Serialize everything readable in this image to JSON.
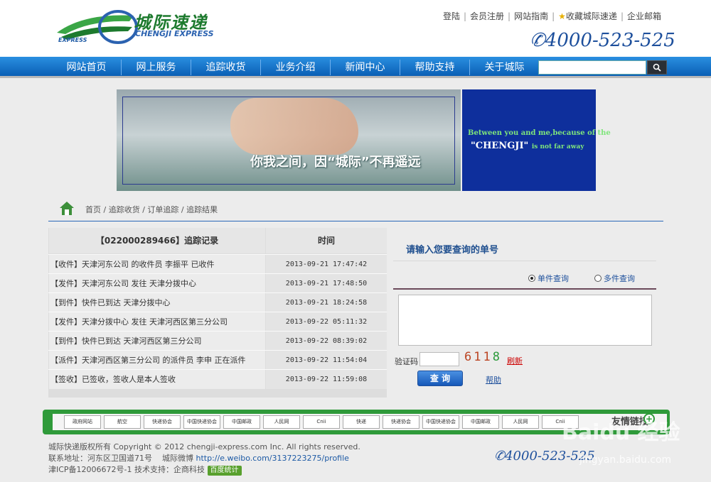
{
  "header": {
    "logo_cn": "城际速递",
    "logo_en": "CHENGJI EXPRESS",
    "logo_express": "EXPRESS",
    "top_links": [
      "登陆",
      "会员注册",
      "网站指南",
      "收藏城际速递",
      "企业邮箱"
    ],
    "hotline": "4000-523-525"
  },
  "nav": {
    "items": [
      "网站首页",
      "网上服务",
      "追踪收货",
      "业务介绍",
      "新闻中心",
      "帮助支持",
      "关于城际"
    ],
    "search_placeholder": "",
    "search_icon": "search-icon"
  },
  "banner": {
    "slogan": "你我之间，因“城际”不再遥远",
    "en_line1": "Between you and me,because of the",
    "en_line2": "\"CHENGJI\"",
    "en_line2_small": "is not far away"
  },
  "breadcrumb": {
    "items": [
      "首页",
      "追踪收货",
      "订单追踪",
      "追踪结果"
    ]
  },
  "tracking": {
    "header_record": "【022000289466】追踪记录",
    "header_time": "时间",
    "rows": [
      {
        "record": "【收件】天津河东公司 的收件员 李振平 已收件",
        "time": "2013-09-21  17:47:42"
      },
      {
        "record": "【发件】天津河东公司 发往 天津分拨中心",
        "time": "2013-09-21  17:48:50"
      },
      {
        "record": "【到件】快件已到达 天津分拨中心",
        "time": "2013-09-21  18:24:58"
      },
      {
        "record": "【发件】天津分拨中心 发往 天津河西区第三分公司",
        "time": "2013-09-22  05:11:32"
      },
      {
        "record": "【到件】快件已到达 天津河西区第三分公司",
        "time": "2013-09-22  08:39:02"
      },
      {
        "record": "【派件】天津河西区第三分公司 的派件员 李申 正在派件",
        "time": "2013-09-22  11:54:04"
      },
      {
        "record": "【签收】已签收，签收人是本人签收",
        "time": "2013-09-22  11:59:08"
      }
    ]
  },
  "query": {
    "title": "请输入您要查询的单号",
    "radio_single": "单件查询",
    "radio_multi": "多件查询",
    "captcha_label": "验证码",
    "captcha_code_a": "611",
    "captcha_code_b": "8",
    "refresh": "刷新",
    "submit": "查 询",
    "help": "帮助"
  },
  "partners": {
    "logos": [
      "政府网站",
      "航空",
      "快递协会",
      "中国快递协会",
      "中国邮政",
      "人民网",
      "Cnii",
      "快递",
      "快递协会",
      "中国快递协会",
      "中国邮政",
      "人民网",
      "Cnii"
    ],
    "links_label": "友情链接"
  },
  "footer": {
    "copyright": "城际快递版权所有 Copyright © 2012 chengji-express.com Inc. All rights reserved.",
    "address": "联系地址：河东区卫国道71号",
    "weibo_label": "城际微博",
    "weibo_url": "http://e.weibo.com/3137223275/profile",
    "icp": "津ICP备12006672号-1 技术支持：企商科技",
    "tongji": "百度统计",
    "hotline": "4000-523-525"
  },
  "watermark": {
    "text": "Baidu 经验",
    "url": "jingyan.baidu.com"
  },
  "colors": {
    "nav_blue": "#0a5fb5",
    "brand_green": "#2f9a3a",
    "link_blue": "#1d4f9c"
  }
}
